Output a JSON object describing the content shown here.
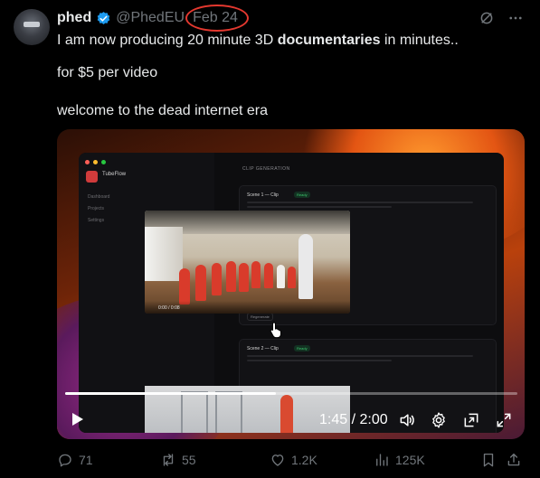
{
  "author": {
    "name": "phed",
    "handle": "@PhedEU",
    "date": "Feb 24"
  },
  "tweet": {
    "line1_start": "I am now producing 20 minute 3D ",
    "line1_bold": "documentaries",
    "line1_end": " in minutes..",
    "line2": "for $5 per video",
    "line3": "welcome to the dead internet era"
  },
  "video_ui": {
    "brand": "TubeFlow",
    "nav": [
      "Dashboard",
      "Projects",
      "Settings"
    ],
    "section_title": "CLIP GENERATION",
    "scene1_title": "Scene 1 — Clip",
    "scene2_title": "Scene 2 — Clip",
    "badge": "Ready",
    "regenerate": "Regenerate",
    "scene1_time": "0:00 / 0:08"
  },
  "player": {
    "time": "1:45 / 2:00",
    "progress": 0.465
  },
  "stats": {
    "replies": "71",
    "reposts": "55",
    "likes": "1.2K",
    "views": "125K"
  },
  "colors": {
    "accent_red": "#e4382f",
    "verified_blue": "#1d9bf0",
    "muted": "#71767b"
  },
  "icons": [
    "verified-icon",
    "grok-icon",
    "more-icon",
    "play-icon",
    "volume-icon",
    "settings-icon",
    "popout-icon",
    "fullscreen-icon",
    "reply-icon",
    "repost-icon",
    "like-icon",
    "views-icon",
    "bookmark-icon",
    "share-icon"
  ]
}
